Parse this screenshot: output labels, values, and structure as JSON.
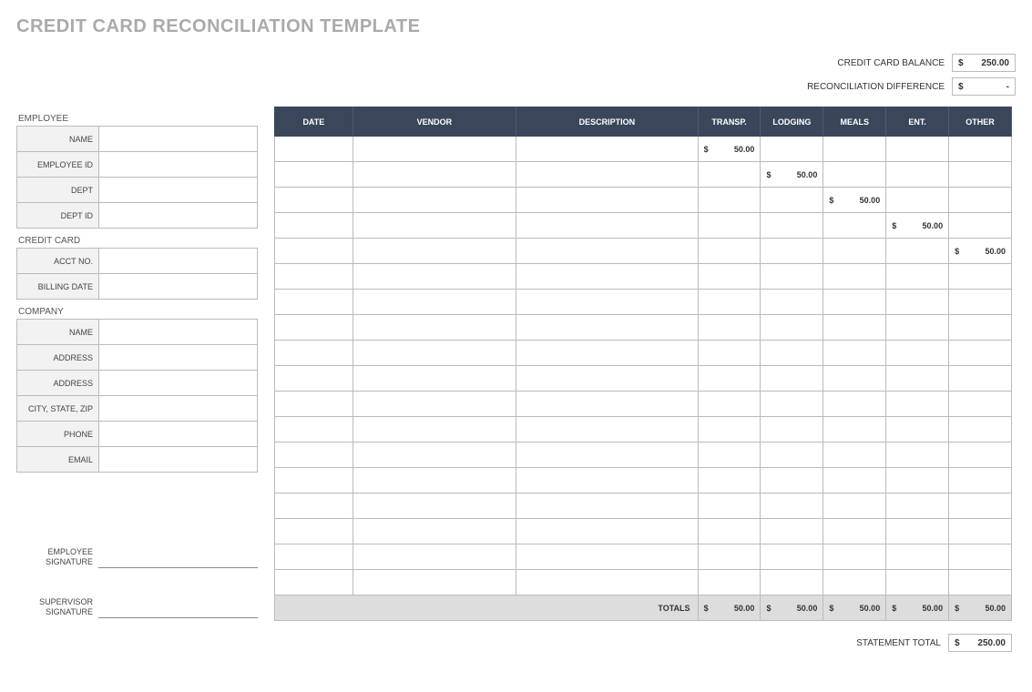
{
  "title": "CREDIT CARD RECONCILIATION TEMPLATE",
  "summary": {
    "balance_label": "CREDIT CARD BALANCE",
    "balance_value": "250.00",
    "diff_label": "RECONCILIATION DIFFERENCE",
    "diff_value": "-"
  },
  "sections": {
    "employee": {
      "heading": "EMPLOYEE",
      "fields": [
        {
          "label": "NAME",
          "value": ""
        },
        {
          "label": "EMPLOYEE ID",
          "value": ""
        },
        {
          "label": "DEPT",
          "value": ""
        },
        {
          "label": "DEPT ID",
          "value": ""
        }
      ]
    },
    "credit_card": {
      "heading": "CREDIT CARD",
      "fields": [
        {
          "label": "ACCT NO.",
          "value": ""
        },
        {
          "label": "BILLING DATE",
          "value": ""
        }
      ]
    },
    "company": {
      "heading": "COMPANY",
      "fields": [
        {
          "label": "NAME",
          "value": ""
        },
        {
          "label": "ADDRESS",
          "value": ""
        },
        {
          "label": "ADDRESS",
          "value": ""
        },
        {
          "label": "CITY, STATE, ZIP",
          "value": ""
        },
        {
          "label": "PHONE",
          "value": ""
        },
        {
          "label": "EMAIL",
          "value": ""
        }
      ]
    }
  },
  "signatures": {
    "employee": "EMPLOYEE SIGNATURE",
    "supervisor": "SUPERVISOR SIGNATURE"
  },
  "table": {
    "headers": [
      "DATE",
      "VENDOR",
      "DESCRIPTION",
      "TRANSP.",
      "LODGING",
      "MEALS",
      "ENT.",
      "OTHER"
    ],
    "rows": [
      {
        "date": "",
        "vendor": "",
        "desc": "",
        "transp": "50.00",
        "lodging": "",
        "meals": "",
        "ent": "",
        "other": ""
      },
      {
        "date": "",
        "vendor": "",
        "desc": "",
        "transp": "",
        "lodging": "50.00",
        "meals": "",
        "ent": "",
        "other": ""
      },
      {
        "date": "",
        "vendor": "",
        "desc": "",
        "transp": "",
        "lodging": "",
        "meals": "50.00",
        "ent": "",
        "other": ""
      },
      {
        "date": "",
        "vendor": "",
        "desc": "",
        "transp": "",
        "lodging": "",
        "meals": "",
        "ent": "50.00",
        "other": ""
      },
      {
        "date": "",
        "vendor": "",
        "desc": "",
        "transp": "",
        "lodging": "",
        "meals": "",
        "ent": "",
        "other": "50.00"
      },
      {
        "date": "",
        "vendor": "",
        "desc": "",
        "transp": "",
        "lodging": "",
        "meals": "",
        "ent": "",
        "other": ""
      },
      {
        "date": "",
        "vendor": "",
        "desc": "",
        "transp": "",
        "lodging": "",
        "meals": "",
        "ent": "",
        "other": ""
      },
      {
        "date": "",
        "vendor": "",
        "desc": "",
        "transp": "",
        "lodging": "",
        "meals": "",
        "ent": "",
        "other": ""
      },
      {
        "date": "",
        "vendor": "",
        "desc": "",
        "transp": "",
        "lodging": "",
        "meals": "",
        "ent": "",
        "other": ""
      },
      {
        "date": "",
        "vendor": "",
        "desc": "",
        "transp": "",
        "lodging": "",
        "meals": "",
        "ent": "",
        "other": ""
      },
      {
        "date": "",
        "vendor": "",
        "desc": "",
        "transp": "",
        "lodging": "",
        "meals": "",
        "ent": "",
        "other": ""
      },
      {
        "date": "",
        "vendor": "",
        "desc": "",
        "transp": "",
        "lodging": "",
        "meals": "",
        "ent": "",
        "other": ""
      },
      {
        "date": "",
        "vendor": "",
        "desc": "",
        "transp": "",
        "lodging": "",
        "meals": "",
        "ent": "",
        "other": ""
      },
      {
        "date": "",
        "vendor": "",
        "desc": "",
        "transp": "",
        "lodging": "",
        "meals": "",
        "ent": "",
        "other": ""
      },
      {
        "date": "",
        "vendor": "",
        "desc": "",
        "transp": "",
        "lodging": "",
        "meals": "",
        "ent": "",
        "other": ""
      },
      {
        "date": "",
        "vendor": "",
        "desc": "",
        "transp": "",
        "lodging": "",
        "meals": "",
        "ent": "",
        "other": ""
      },
      {
        "date": "",
        "vendor": "",
        "desc": "",
        "transp": "",
        "lodging": "",
        "meals": "",
        "ent": "",
        "other": ""
      },
      {
        "date": "",
        "vendor": "",
        "desc": "",
        "transp": "",
        "lodging": "",
        "meals": "",
        "ent": "",
        "other": ""
      }
    ],
    "totals": {
      "label": "TOTALS",
      "transp": "50.00",
      "lodging": "50.00",
      "meals": "50.00",
      "ent": "50.00",
      "other": "50.00"
    }
  },
  "statement": {
    "label": "STATEMENT TOTAL",
    "value": "250.00"
  },
  "currency": "$"
}
